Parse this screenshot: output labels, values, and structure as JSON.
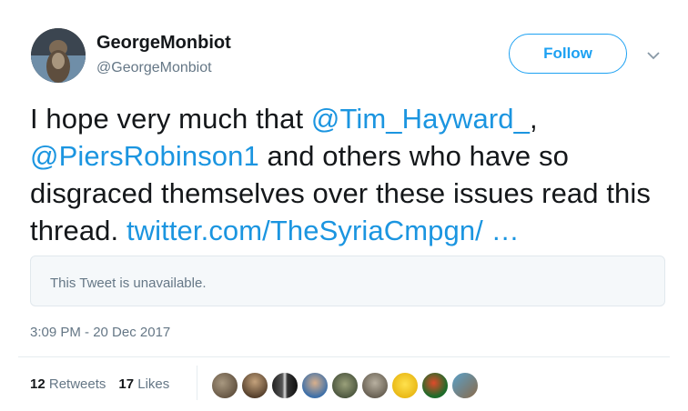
{
  "author": {
    "name": "GeorgeMonbiot",
    "handle": "@GeorgeMonbiot"
  },
  "actions": {
    "follow_label": "Follow"
  },
  "tweet": {
    "text_part1": "I hope very much that ",
    "mention1": "@Tim_Hayward_",
    "text_part2": ", ",
    "mention2": "@PiersRobinson1",
    "text_part3": " and others who have so disgraced themselves over these issues read this thread. ",
    "link": "twitter.com/TheSyriaCmpgn/ …"
  },
  "quoted": {
    "message": "This Tweet is unavailable."
  },
  "timestamp": "3:09 PM - 20 Dec 2017",
  "stats": {
    "retweets_count": "12",
    "retweets_label": "Retweets",
    "likes_count": "17",
    "likes_label": "Likes"
  },
  "colors": {
    "accent": "#1da1f2",
    "link": "#1b95e0",
    "muted": "#657786",
    "quote_bg": "#f5f8fa"
  },
  "liker_avatars": [
    "avatar-1",
    "avatar-2",
    "avatar-3",
    "avatar-4",
    "avatar-5",
    "avatar-6",
    "avatar-7",
    "avatar-8",
    "avatar-9"
  ]
}
